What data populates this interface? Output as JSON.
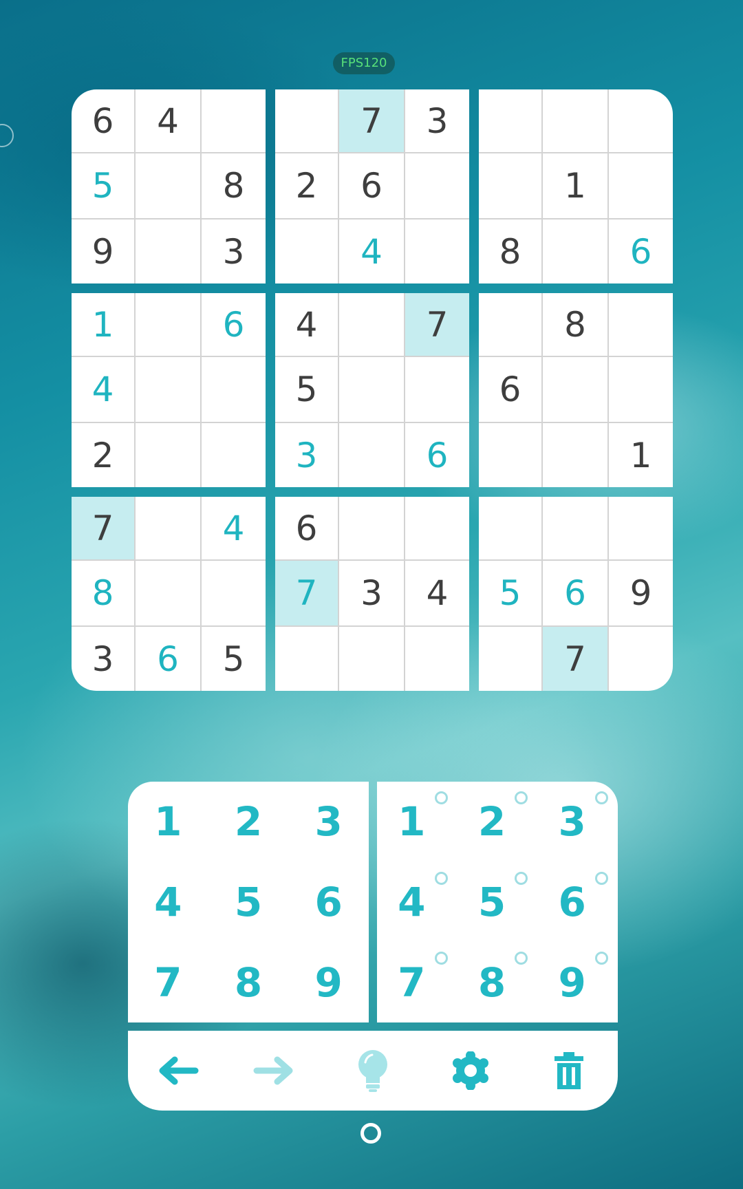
{
  "status": {
    "fps_label": "FPS120"
  },
  "board": {
    "rows": [
      [
        "6",
        "4",
        "",
        "",
        "7",
        "3",
        "",
        "",
        ""
      ],
      [
        "5",
        "",
        "8",
        "2",
        "6",
        "",
        "",
        "1",
        ""
      ],
      [
        "9",
        "",
        "3",
        "",
        "4",
        "",
        "8",
        "",
        "6"
      ],
      [
        "1",
        "",
        "6",
        "4",
        "",
        "7",
        "",
        "8",
        ""
      ],
      [
        "4",
        "",
        "",
        "5",
        "",
        "",
        "6",
        "",
        ""
      ],
      [
        "2",
        "",
        "",
        "3",
        "",
        "6",
        "",
        "",
        "1"
      ],
      [
        "7",
        "",
        "4",
        "6",
        "",
        "",
        "",
        "",
        ""
      ],
      [
        "8",
        "",
        "",
        "7",
        "3",
        "4",
        "5",
        "6",
        "9"
      ],
      [
        "3",
        "6",
        "5",
        "",
        "",
        "",
        "",
        "7",
        ""
      ]
    ],
    "entered_cells": [
      "1-0",
      "2-4",
      "2-8",
      "3-0",
      "3-2",
      "4-0",
      "5-3",
      "5-5",
      "6-2",
      "7-0",
      "7-3",
      "7-6",
      "7-7",
      "8-1"
    ],
    "highlighted_cells": [
      "0-4",
      "3-5",
      "6-0",
      "7-3",
      "8-7"
    ],
    "highlight_color": "#c6edf0",
    "given_color": "#3e3e3e",
    "entered_color": "#1fb4c0"
  },
  "number_pad": {
    "keys": [
      "1",
      "2",
      "3",
      "4",
      "5",
      "6",
      "7",
      "8",
      "9"
    ],
    "note_keys": [
      "1",
      "2",
      "3",
      "4",
      "5",
      "6",
      "7",
      "8",
      "9"
    ],
    "accent_color": "#22b8c4"
  },
  "toolbar": {
    "undo_icon": "arrow-left-icon",
    "redo_icon": "arrow-right-icon",
    "hint_icon": "lightbulb-icon",
    "settings_icon": "gear-icon",
    "erase_icon": "trash-icon"
  }
}
